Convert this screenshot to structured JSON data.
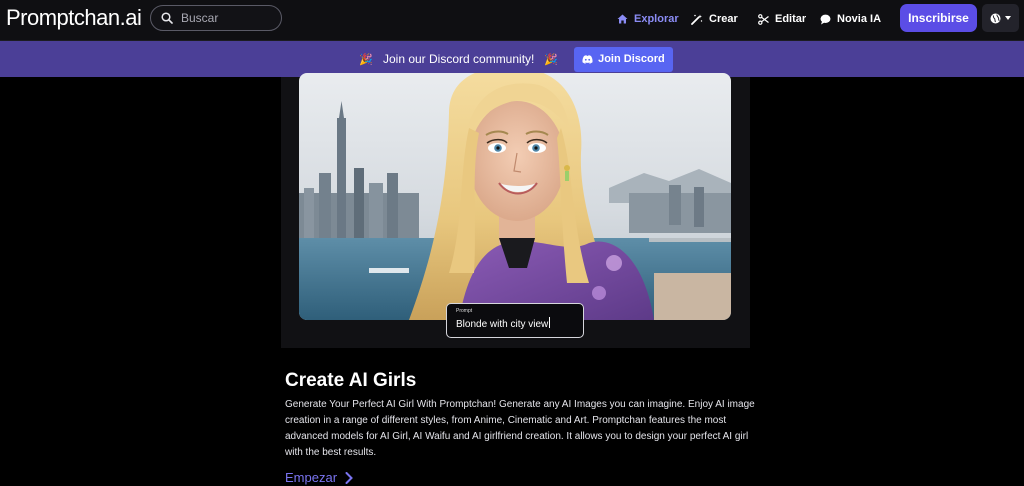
{
  "header": {
    "logo": "Promptchan.ai",
    "search_placeholder": "Buscar",
    "nav": [
      {
        "label": "Explorar",
        "icon": "home-icon",
        "active": true
      },
      {
        "label": "Crear",
        "icon": "magic-wand-icon"
      },
      {
        "label": "Editar",
        "icon": "scissors-icon"
      },
      {
        "label": "Novia IA",
        "icon": "chat-bubble-icon"
      }
    ],
    "signup_label": "Inscribirse",
    "language_icon": "globe-icon"
  },
  "banner": {
    "text": "Join our Discord community!",
    "button_label": "Join Discord"
  },
  "hero": {
    "prompt_label": "Prompt",
    "prompt_value": "Blonde with city view"
  },
  "content": {
    "title": "Create AI Girls",
    "description": "Generate Your Perfect AI Girl With Promptchan! Generate any AI Images you can imagine. Enjoy AI image creation in a range of different styles, from Anime, Cinematic and Art. Promptchan features the most advanced models for AI Girl, AI Waifu and AI girlfriend creation. It allows you to design your perfect AI girl with the best results.",
    "cta_label": "Empezar"
  },
  "colors": {
    "accent": "#5b4de6",
    "banner": "#4b3f97",
    "link": "#7a74f0"
  }
}
